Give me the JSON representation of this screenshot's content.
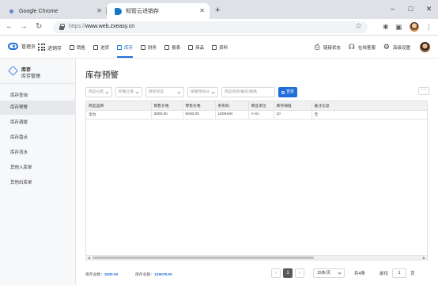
{
  "browser": {
    "tabs": [
      {
        "title": "Google Chrome"
      },
      {
        "title": "知管云进销存"
      }
    ],
    "url_scheme": "https://",
    "url_host": "www.web.zxeasy.cn"
  },
  "header": {
    "logo_text": "管理员",
    "app_switch_label": "进销存",
    "modules": [
      {
        "label": "销售",
        "active": false
      },
      {
        "label": "进货",
        "active": false
      },
      {
        "label": "库存",
        "active": true
      },
      {
        "label": "财务",
        "active": false
      },
      {
        "label": "报表",
        "active": false
      },
      {
        "label": "商品",
        "active": false
      },
      {
        "label": "资料",
        "active": false
      }
    ],
    "tools": {
      "printer": "链接状态",
      "support": "在线客服",
      "settings": "高级设置"
    }
  },
  "sidebar": {
    "title": "库存",
    "subtitle": "库存管理",
    "items": [
      {
        "label": "库存查询"
      },
      {
        "label": "库存预警"
      },
      {
        "label": "库存调拨"
      },
      {
        "label": "库存盘点"
      },
      {
        "label": "库存流水"
      },
      {
        "label": "其他入库单"
      },
      {
        "label": "其他出库单"
      }
    ],
    "active_index": 1
  },
  "main": {
    "title": "库存预警",
    "filters": {
      "category": "商品分类",
      "warehouse": "所属仓库",
      "stock_status": "库存状态",
      "supplier": "按属性标分",
      "keyword_placeholder": "商品名称/编号/规格",
      "query_button": "查找"
    },
    "table": {
      "columns": [
        "商品品牌",
        "销售价格",
        "零售价格",
        "条形码",
        "商品货位",
        "库存阈值",
        "备注信息"
      ],
      "rows": [
        [
          "华为",
          "3500.00",
          "5000.00",
          "1009400",
          "A-01",
          "10",
          "无"
        ]
      ]
    },
    "footer": {
      "stock_total_label": "库存总数：",
      "stock_total_value": "3400.00",
      "stock_amount_label": "库存总额：",
      "stock_amount_value": "129078.00",
      "current_page": "1",
      "page_size": "15条/页",
      "total": "共4条",
      "goto_label": "前往",
      "goto_value": "1",
      "page_unit": "页"
    }
  }
}
